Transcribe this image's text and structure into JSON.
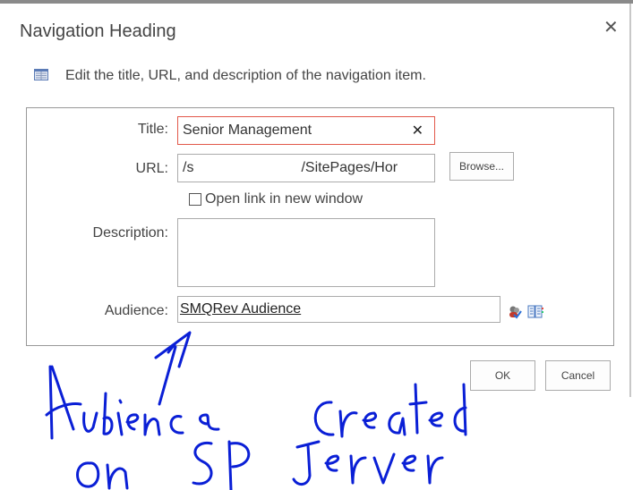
{
  "dialog": {
    "title": "Navigation Heading",
    "close_icon": "close-icon",
    "intro_icon": "list-icon",
    "intro_text": "Edit the title, URL, and description of the navigation item."
  },
  "form": {
    "title_label": "Title:",
    "title_value": "Senior Management",
    "title_clear": "✕",
    "url_label": "URL:",
    "url_value": "/s                           /SitePages/Hor",
    "browse_label": "Browse...",
    "open_new_window_label": "Open link in new window",
    "open_new_window_checked": false,
    "description_label": "Description:",
    "description_value": "",
    "audience_label": "Audience:",
    "audience_value": "SMQRev Audience",
    "check_names_icon": "check-names-icon",
    "browse_audience_icon": "address-book-icon"
  },
  "buttons": {
    "ok": "OK",
    "cancel": "Cancel"
  },
  "annotation": {
    "text": "Audience created on SP Server",
    "color": "#0a1fd6"
  }
}
